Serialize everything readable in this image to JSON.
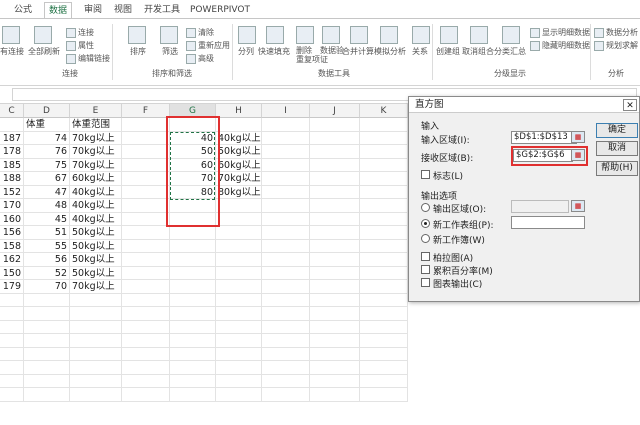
{
  "tabs": [
    "公式",
    "数据",
    "审阅",
    "视图",
    "开发工具",
    "POWERPIVOT"
  ],
  "active_tab": "数据",
  "title_hint": "…",
  "ribbon": {
    "connections": {
      "items": [
        "连接",
        "属性",
        "编辑链接"
      ],
      "big": [
        "有连接",
        "全部刷新"
      ],
      "group": "连接"
    },
    "sort": {
      "sort": "排序",
      "filter": "筛选",
      "items": [
        "清除",
        "重新应用",
        "高级"
      ],
      "group": "排序和筛选"
    },
    "tools": {
      "items": [
        "分列",
        "快速填充",
        "删除\n重复项",
        "数据验\n证",
        "合并计算",
        "模拟分析",
        "关系"
      ],
      "group": "数据工具"
    },
    "outline": {
      "items": [
        "创建组",
        "取消组合",
        "分类汇总"
      ],
      "small": [
        "显示明细数据",
        "隐藏明细数据"
      ],
      "group": "分级显示"
    },
    "analysis": {
      "items": [
        "数据分析",
        "规划求解"
      ],
      "group": "分析"
    }
  },
  "columns": [
    "C",
    "D",
    "E",
    "F",
    "G",
    "H",
    "I",
    "J",
    "K"
  ],
  "selected_column": "G",
  "headers": {
    "D": "体重",
    "E": "体重范围"
  },
  "rows": [
    {
      "C": "187",
      "D": "74",
      "E": "70kg以上"
    },
    {
      "C": "178",
      "D": "76",
      "E": "70kg以上"
    },
    {
      "C": "185",
      "D": "75",
      "E": "70kg以上"
    },
    {
      "C": "188",
      "D": "67",
      "E": "60kg以上"
    },
    {
      "C": "152",
      "D": "47",
      "E": "40kg以上"
    },
    {
      "C": "170",
      "D": "48",
      "E": "40kg以上"
    },
    {
      "C": "160",
      "D": "45",
      "E": "40kg以上"
    },
    {
      "C": "156",
      "D": "51",
      "E": "50kg以上"
    },
    {
      "C": "158",
      "D": "55",
      "E": "50kg以上"
    },
    {
      "C": "162",
      "D": "56",
      "E": "50kg以上"
    },
    {
      "C": "150",
      "D": "52",
      "E": "50kg以上"
    },
    {
      "C": "179",
      "D": "70",
      "E": "70kg以上"
    }
  ],
  "bins": [
    {
      "G": "40",
      "H": "40kg以上"
    },
    {
      "G": "50",
      "H": "50kg以上"
    },
    {
      "G": "60",
      "H": "60kg以上"
    },
    {
      "G": "70",
      "H": "70kg以上"
    },
    {
      "G": "80",
      "H": "80kg以上"
    }
  ],
  "dialog": {
    "title": "直方图",
    "input_section": "输入",
    "input_range_label": "输入区域(I):",
    "input_range_value": "$D$1:$D$13",
    "bin_range_label": "接收区域(B):",
    "bin_range_value": "$G$2:$G$6",
    "labels_label": "标志(L)",
    "output_section": "输出选项",
    "out_range_label": "输出区域(O):",
    "new_sheet_label": "新工作表组(P):",
    "new_book_label": "新工作簿(W)",
    "pareto_label": "柏拉图(A)",
    "cumulative_label": "累积百分率(M)",
    "chart_label": "图表输出(C)",
    "ok": "确定",
    "cancel": "取消",
    "help": "帮助(H)"
  }
}
